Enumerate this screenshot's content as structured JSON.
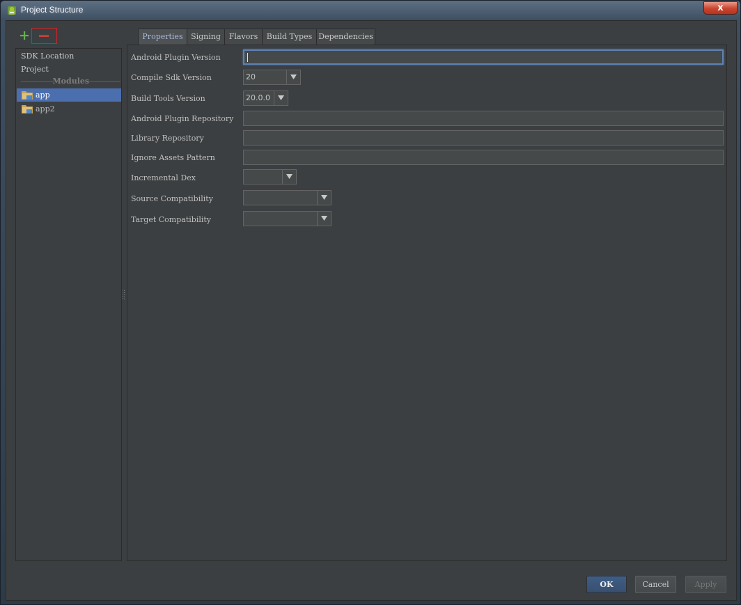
{
  "window": {
    "title": "Project Structure",
    "close_label": "x"
  },
  "toolbar": {
    "add_icon": "plus-icon",
    "remove_icon": "minus-icon"
  },
  "sidebar": {
    "items": [
      {
        "label": "SDK Location"
      },
      {
        "label": "Project"
      }
    ],
    "modules_header": "Modules",
    "modules": [
      {
        "label": "app",
        "selected": true
      },
      {
        "label": "app2",
        "selected": false
      }
    ]
  },
  "tabs": [
    {
      "label": "Properties",
      "active": true
    },
    {
      "label": "Signing",
      "active": false
    },
    {
      "label": "Flavors",
      "active": false
    },
    {
      "label": "Build Types",
      "active": false
    },
    {
      "label": "Dependencies",
      "active": false
    }
  ],
  "form": {
    "android_plugin_version": {
      "label": "Android Plugin Version",
      "value": ""
    },
    "compile_sdk_version": {
      "label": "Compile Sdk Version",
      "value": "20"
    },
    "build_tools_version": {
      "label": "Build Tools Version",
      "value": "20.0.0"
    },
    "android_plugin_repository": {
      "label": "Android Plugin Repository",
      "value": ""
    },
    "library_repository": {
      "label": "Library Repository",
      "value": ""
    },
    "ignore_assets_pattern": {
      "label": "Ignore Assets Pattern",
      "value": ""
    },
    "incremental_dex": {
      "label": "Incremental Dex",
      "value": ""
    },
    "source_compatibility": {
      "label": "Source Compatibility",
      "value": ""
    },
    "target_compatibility": {
      "label": "Target Compatibility",
      "value": ""
    }
  },
  "buttons": {
    "ok": "OK",
    "cancel": "Cancel",
    "apply": "Apply"
  },
  "colors": {
    "background": "#3c3f41",
    "selection": "#4b6eaf",
    "focus_border": "#5c82b4",
    "add_icon": "#5fb34d",
    "remove_icon": "#d9403a",
    "remove_highlight": "#d42424"
  }
}
